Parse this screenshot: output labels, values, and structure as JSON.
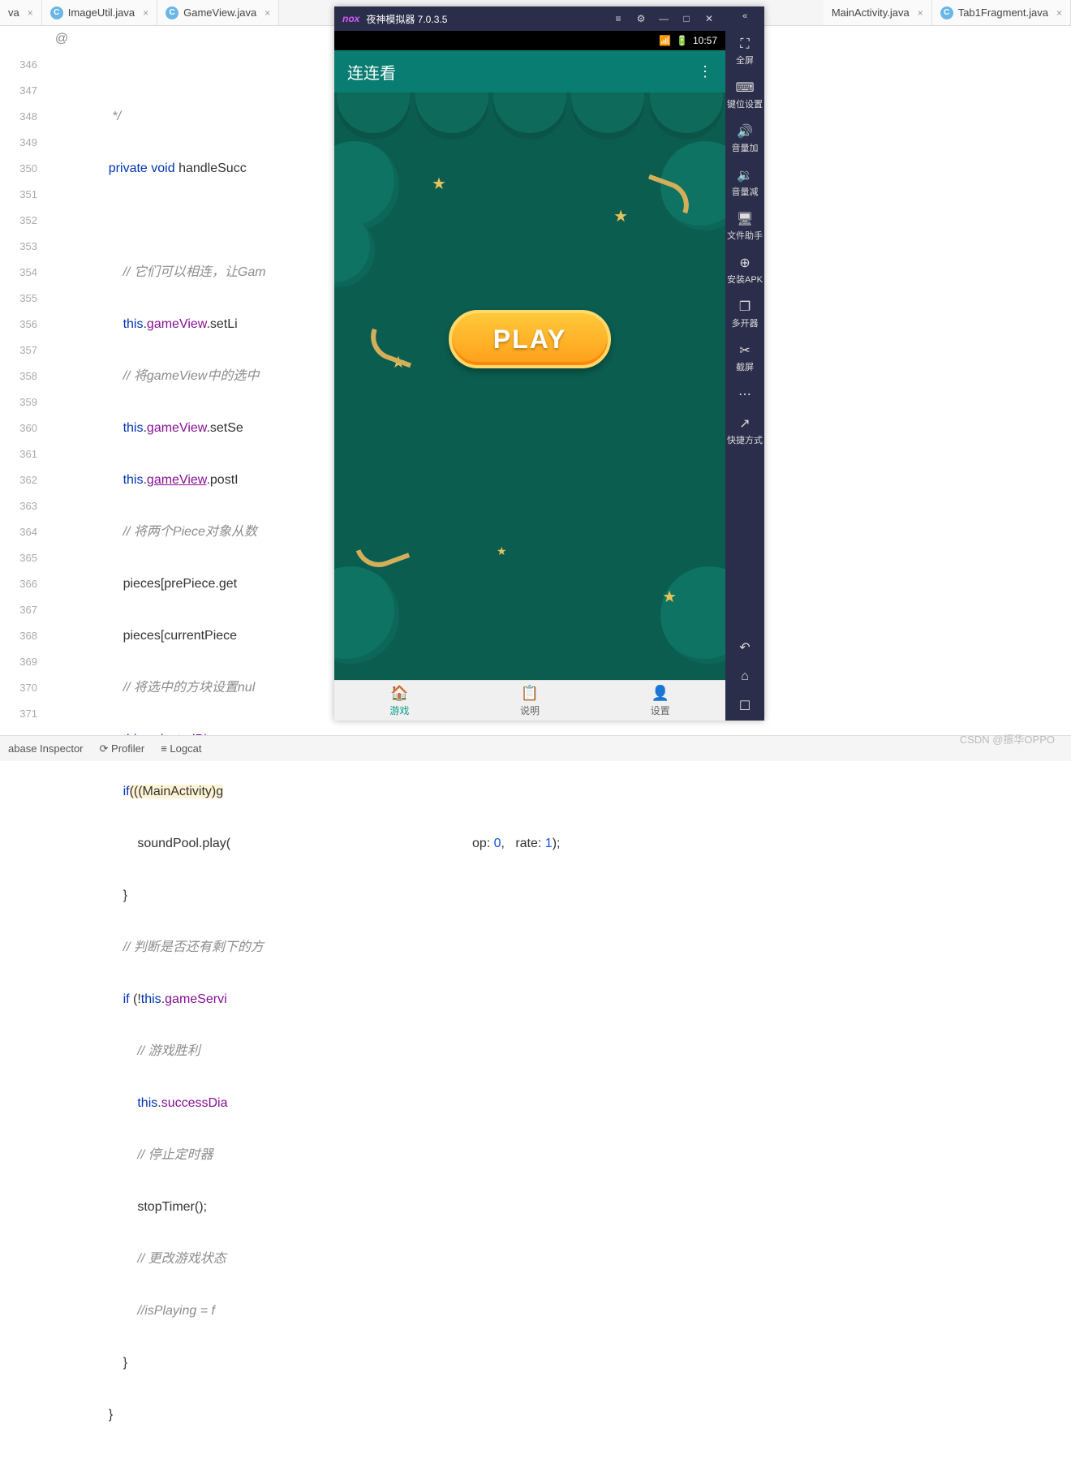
{
  "tabs": {
    "t0": "va",
    "t1": "ImageUtil.java",
    "t2": "GameView.java",
    "t3": "MainActivity.java",
    "t4": "Tab1Fragment.java"
  },
  "editor": {
    "lines": [
      "346",
      "347",
      "348",
      "349",
      "350",
      "351",
      "352",
      "353",
      "354",
      "355",
      "356",
      "357",
      "358",
      "359",
      "360",
      "361",
      "362",
      "363",
      "364",
      "365",
      "366",
      "367",
      "368",
      "369",
      "370",
      "371"
    ],
    "ann347": "@",
    "l345": "*/",
    "l347_kw1": "private",
    "l347_kw2": "void",
    "l347_m": "handleSucc",
    "l349_c": "// 它们可以相连，让Gam",
    "l350_t": "this",
    "l350_f": "gameView",
    "l350_m": ".setLi",
    "l351_c": "// 将gameView中的选中",
    "l352_t": "this",
    "l352_f": "gameView",
    "l352_m": ".setSe",
    "l353_t": "this",
    "l353_f": "gameView",
    "l353_m": ".postI",
    "l354_c": "// 将两个Piece对象从数",
    "l355": "pieces[prePiece.get",
    "l356": "pieces[currentPiece",
    "l357_c": "// 将选中的方块设置nul",
    "l358_t": "this",
    "l358_f": "selectedPiece",
    "l359_if": "if",
    "l359_body": "(((MainActivity)g",
    "l360_a": "soundPool",
    "l360_b": ".play(",
    "l361": "}",
    "l362_c": "// 判断是否还有剩下的方",
    "l363_if": "if",
    "l363_a": " (!",
    "l363_t": "this",
    "l363_f": "gameServi",
    "l364_c": "// 游戏胜利",
    "l365_t": "this",
    "l365_f": "successDia",
    "l366_c": "// 停止定时器",
    "l367": "stopTimer();",
    "l368_c": "// 更改游戏状态",
    "l369_c": "//isPlaying = f",
    "l370": "}",
    "l371": "}",
    "tail_a": "op: ",
    "tail_n1": "0",
    "tail_b": ",   rate: ",
    "tail_n2": "1",
    "tail_c": ");"
  },
  "emu": {
    "title_logo": "nox",
    "title": "夜神模拟器 7.0.3.5",
    "time": "10:57",
    "appbar_title": "连连看",
    "play": "PLAY",
    "nav": {
      "game": "游戏",
      "help": "说明",
      "settings": "设置"
    },
    "side": {
      "fullscreen": "全屏",
      "keymap": "键位设置",
      "volup": "音量加",
      "voldown": "音量减",
      "file": "文件助手",
      "apk": "安装APK",
      "multi": "多开器",
      "shot": "截屏",
      "shortcut": "快捷方式"
    }
  },
  "bottom": {
    "db": "abase Inspector",
    "profiler": "Profiler",
    "logcat": "Logcat"
  },
  "watermark": "CSDN @振华OPPO"
}
